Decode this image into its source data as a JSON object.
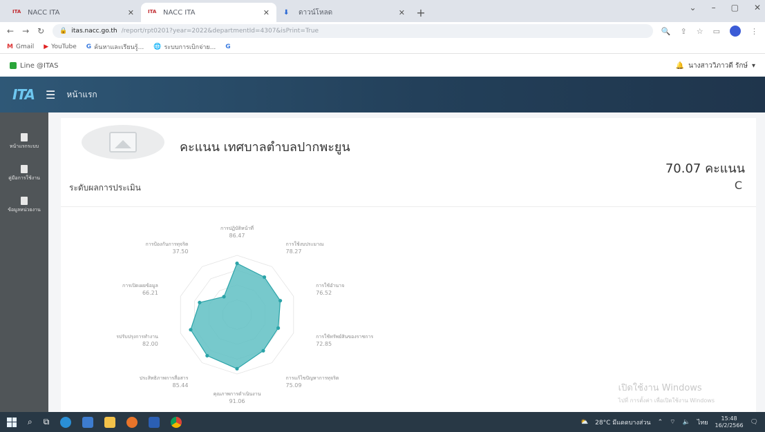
{
  "browser": {
    "tabs": [
      {
        "title": "NACC ITA",
        "active": false,
        "favicon": "ita-favicon"
      },
      {
        "title": "NACC ITA",
        "active": true,
        "favicon": "ita-favicon"
      },
      {
        "title": "ดาวน์โหลด",
        "active": false,
        "favicon": "download-icon"
      }
    ],
    "new_tab": "+",
    "url_host": "itas.nacc.go.th",
    "url_path": "/report/rpt0201?year=2022&departmentId=4307&isPrint=True",
    "bookmarks": [
      "Gmail",
      "YouTube",
      "ค้นหาและเรียนรู้...",
      "ระบบการเบิกจ่าย...",
      "G"
    ]
  },
  "app": {
    "line_link": "Line @ITAS",
    "user_name": "นางสาววิภาวดี รักษ์",
    "logo_text": "ITA",
    "nav_home": "หน้าแรก",
    "sidebar": [
      {
        "label": "หน้าแรกระบบ",
        "icon": "home-icon"
      },
      {
        "label": "คู่มือการใช้งาน",
        "icon": "book-icon"
      },
      {
        "label": "ข้อมูลหน่วยงาน",
        "icon": "document-icon"
      }
    ]
  },
  "report": {
    "title": "คะแนน เทศบาลตำบลปากพะยูน",
    "score": "70.07 คะแนน",
    "level_label": "ระดับผลการประเมิน",
    "grade": "C"
  },
  "chart_data": {
    "type": "radar",
    "title": "",
    "range": [
      0,
      100
    ],
    "categories": [
      "การปฏิบัติหน้าที่",
      "การใช้งบประมาณ",
      "การใช้อำนาจ",
      "การใช้ทรัพย์สินของราชการ",
      "การแก้ไขปัญหาการทุจริต",
      "คุณภาพการดำเนินงาน",
      "ประสิทธิภาพการสื่อสาร",
      "การปรับปรุงการทำงาน",
      "การเปิดเผยข้อมูล",
      "การป้องกันการทุจริต"
    ],
    "values": [
      86.47,
      78.27,
      76.52,
      72.85,
      75.09,
      91.06,
      85.44,
      82.0,
      66.21,
      37.5
    ],
    "fill_color": "#5fc0c3",
    "stroke_color": "#2aa3a8"
  },
  "watermark": {
    "line1": "เปิดใช้งาน Windows",
    "line2": "ไปที่ การตั้งค่า เพื่อเปิดใช้งาน Windows"
  },
  "taskbar": {
    "weather": "28°C มีแดดบางส่วน",
    "time": "15:48",
    "date": "16/2/2566",
    "lang": "ไทย"
  }
}
